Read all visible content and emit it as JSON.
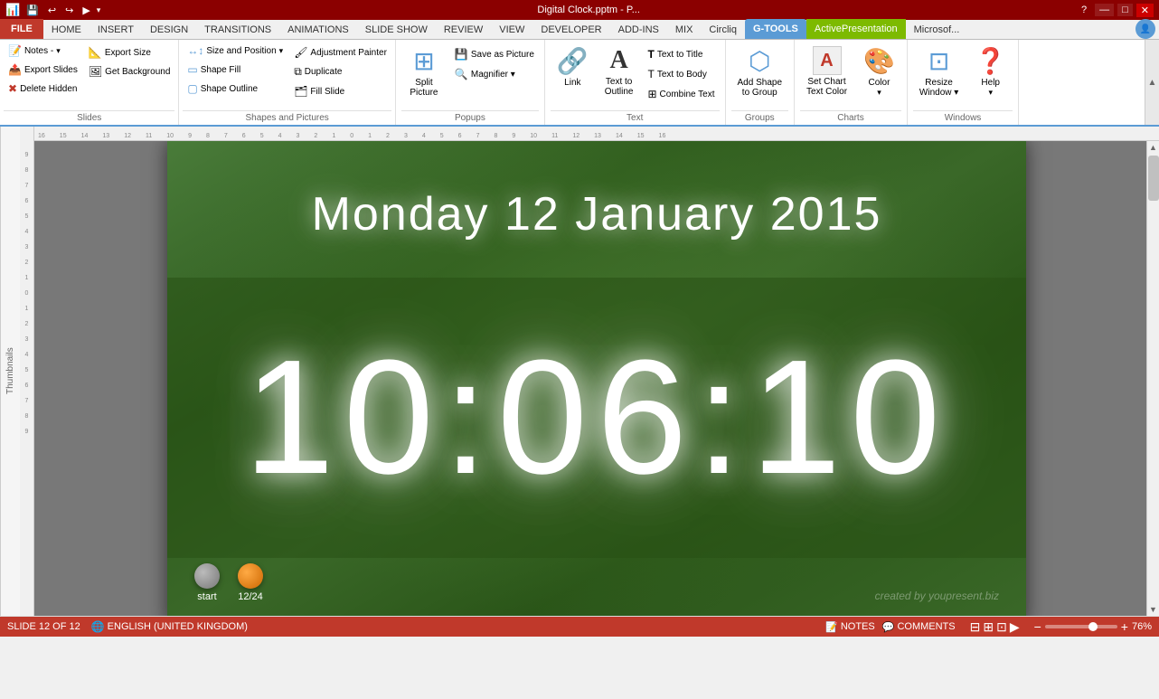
{
  "titlebar": {
    "title": "Digital Clock.pptm - P...",
    "minimize": "—",
    "maximize": "□",
    "close": "✕",
    "help": "?"
  },
  "qat": {
    "buttons": [
      "💾",
      "↩",
      "↪",
      "▶"
    ]
  },
  "ribbon_tabs": {
    "tabs": [
      "FILE",
      "HOME",
      "INSERT",
      "DESIGN",
      "TRANSITIONS",
      "ANIMATIONS",
      "SLIDE SHOW",
      "REVIEW",
      "VIEW",
      "DEVELOPER",
      "ADD-INS",
      "MIX",
      "Circliq",
      "G-TOOLS",
      "ActivePresentation",
      "Microsof..."
    ]
  },
  "ribbon": {
    "groups": {
      "slides": {
        "label": "Slides",
        "buttons": [
          {
            "icon": "📝",
            "label": "Notes -"
          },
          {
            "icon": "📤",
            "label": "Export Slides"
          },
          {
            "icon": "🗑",
            "label": "Delete Hidden"
          }
        ],
        "small_buttons": [
          {
            "icon": "📐",
            "label": "Export Size"
          },
          {
            "icon": "🖼",
            "label": "Get Background"
          }
        ]
      },
      "shapes": {
        "label": "Shapes and Pictures",
        "buttons": [
          {
            "icon": "↔",
            "label": "Size and Position"
          },
          {
            "icon": "🎨",
            "label": "Shape Fill"
          },
          {
            "icon": "▭",
            "label": "Shape Outline"
          }
        ],
        "small_buttons": [
          {
            "icon": "🖌",
            "label": "Adjustment Painter"
          },
          {
            "icon": "⧉",
            "label": "Duplicate"
          },
          {
            "icon": "🗂",
            "label": "Fill Slide"
          }
        ]
      },
      "popups": {
        "label": "Popups",
        "buttons": [
          {
            "icon": "✂",
            "label": "Split Picture"
          }
        ],
        "small_buttons": [
          {
            "icon": "💾",
            "label": "Save as Picture"
          },
          {
            "icon": "🔍",
            "label": "Magnifier ▾"
          }
        ]
      },
      "text": {
        "label": "Text",
        "buttons": [
          {
            "icon": "🔗",
            "label": "Link"
          },
          {
            "icon": "A",
            "label": "Text to Outline"
          }
        ],
        "small_buttons": [
          {
            "icon": "T",
            "label": "Text to Title"
          },
          {
            "icon": "T",
            "label": "Text to Body"
          },
          {
            "icon": "⊞",
            "label": "Combine Text"
          }
        ]
      },
      "groups_g": {
        "label": "Groups",
        "buttons": [
          {
            "icon": "⬡",
            "label": "Add Shape to Group"
          }
        ]
      },
      "charts": {
        "label": "Charts",
        "buttons": [
          {
            "icon": "A",
            "label": "Set Chart Text Color"
          },
          {
            "icon": "🎨",
            "label": "Color"
          }
        ]
      },
      "windows": {
        "label": "Windows",
        "buttons": [
          {
            "icon": "⊡",
            "label": "Resize Window"
          },
          {
            "icon": "❓",
            "label": "Help"
          }
        ]
      }
    }
  },
  "slide": {
    "date": "Monday 12 January 2015",
    "time": "10:06:10",
    "buttons": [
      {
        "label": "start",
        "color": "gray"
      },
      {
        "label": "12/24",
        "color": "orange"
      }
    ],
    "watermark": "created by youpresent.biz"
  },
  "statusbar": {
    "slide_info": "SLIDE 12 OF 12",
    "language": "ENGLISH (UNITED KINGDOM)",
    "notes_label": "NOTES",
    "comments_label": "COMMENTS",
    "zoom": "76%",
    "view_buttons": [
      "normal",
      "slide_sorter",
      "reading",
      "slideshow"
    ]
  },
  "notes": {
    "label": "Notes -"
  }
}
